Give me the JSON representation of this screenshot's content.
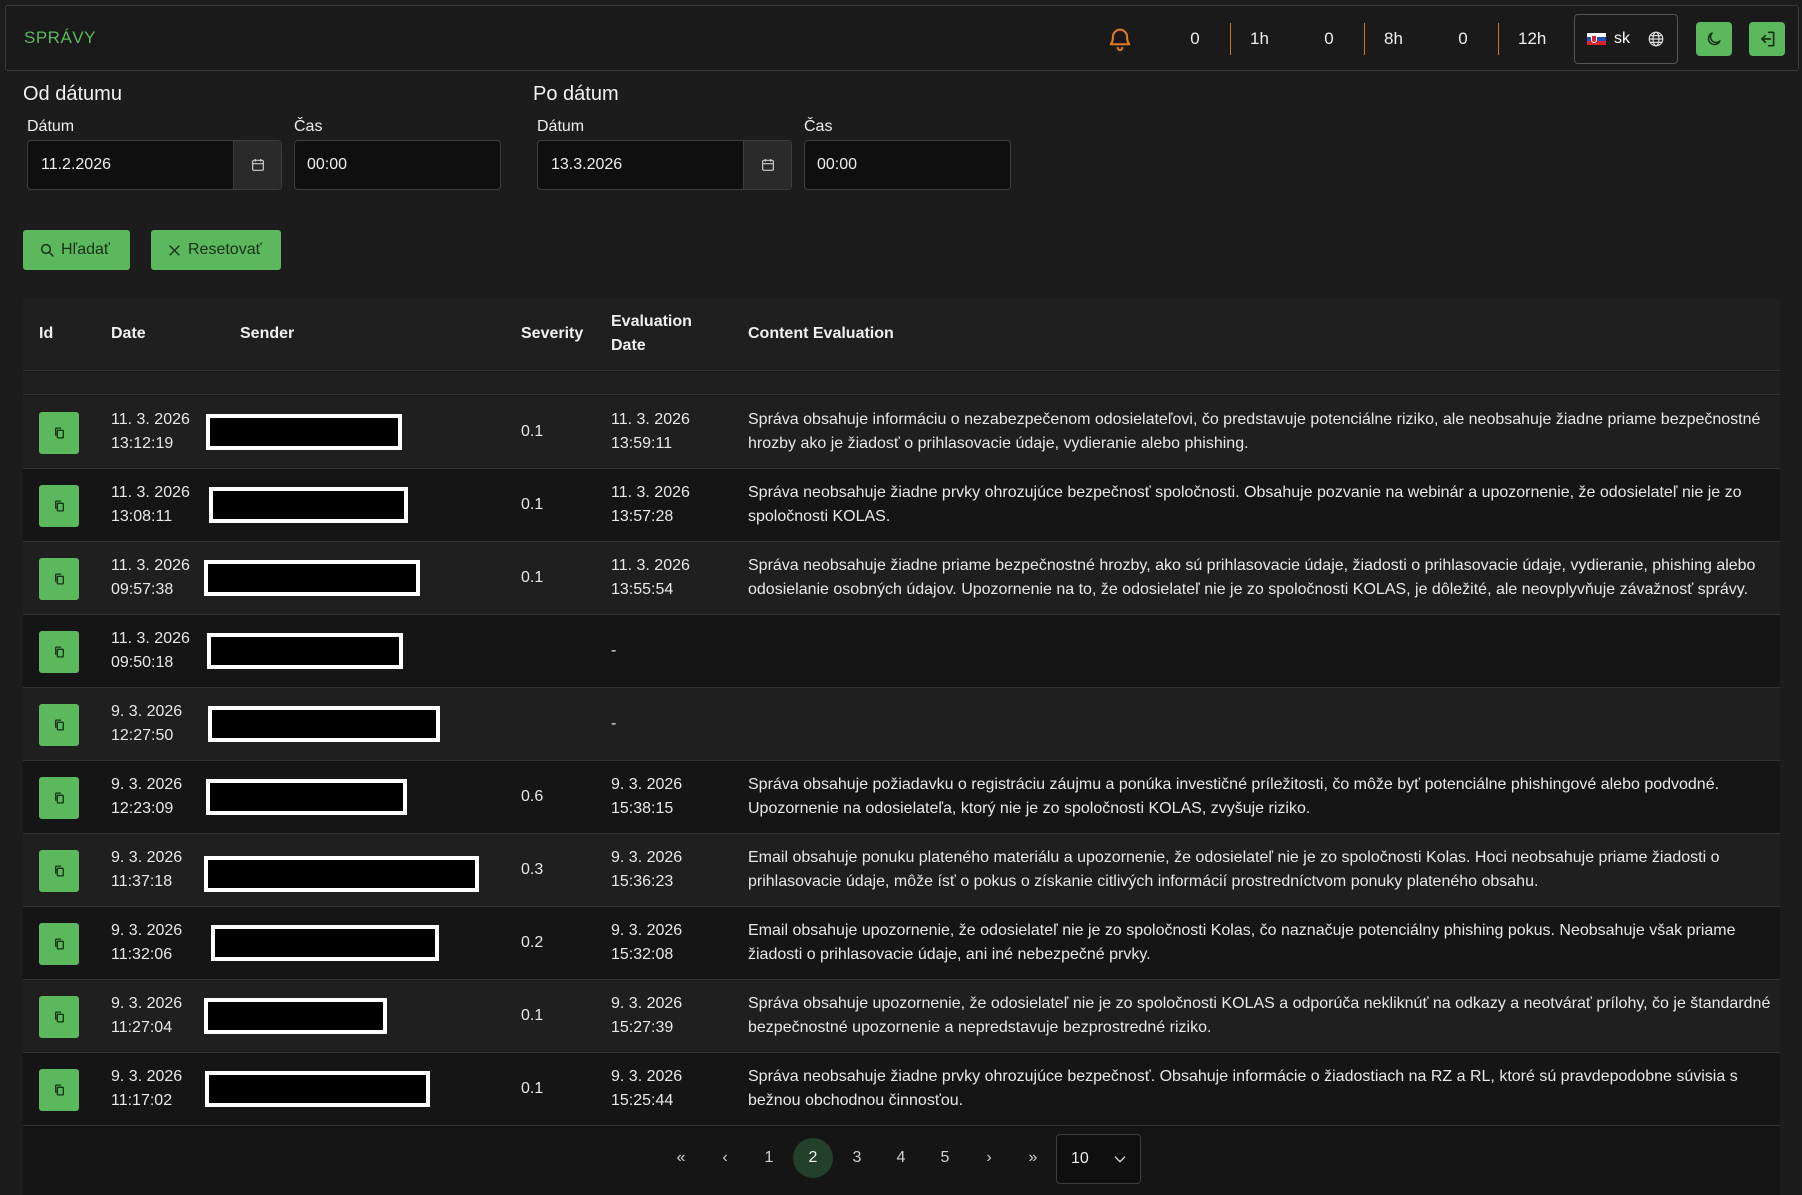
{
  "brand": "SPRÁVY",
  "header_stats": [
    {
      "count": "0",
      "window": "1h"
    },
    {
      "count": "0",
      "window": "8h"
    },
    {
      "count": "0",
      "window": "12h"
    }
  ],
  "language": "sk",
  "colors": {
    "accent": "#5cb85c",
    "bell": "#e07b1a",
    "background": "#1c1c1c"
  },
  "filters": {
    "from": {
      "title": "Od dátumu",
      "date_label": "Dátum",
      "date_value": "11.2.2026",
      "time_label": "Čas",
      "time_value": "00:00"
    },
    "to": {
      "title": "Po dátum",
      "date_label": "Dátum",
      "date_value": "13.3.2026",
      "time_label": "Čas",
      "time_value": "00:00"
    }
  },
  "buttons": {
    "search": "Hľadať",
    "reset": "Resetovať"
  },
  "table": {
    "columns": {
      "id": "Id",
      "date": "Date",
      "sender": "Sender",
      "severity": "Severity",
      "eval_date_1": "Evaluation",
      "eval_date_2": "Date",
      "content": "Content Evaluation"
    },
    "rows": [
      {
        "date": "11. 3. 2026",
        "time": "13:12:19",
        "severity": "0.1",
        "eval_date": "11. 3. 2026",
        "eval_time": "13:59:11",
        "content": "Správa obsahuje informáciu o nezabezpečenom odosielateľovi, čo predstavuje potenciálne riziko, ale neobsahuje žiadne priame bezpečnostné hrozby ako je žiadosť o prihlasovacie údaje, vydieranie alebo phishing."
      },
      {
        "date": "11. 3. 2026",
        "time": "13:08:11",
        "severity": "0.1",
        "eval_date": "11. 3. 2026",
        "eval_time": "13:57:28",
        "content": "Správa neobsahuje žiadne prvky ohrozujúce bezpečnosť spoločnosti. Obsahuje pozvanie na webinár a upozornenie, že odosielateľ nie je zo spoločnosti KOLAS."
      },
      {
        "date": "11. 3. 2026",
        "time": "09:57:38",
        "severity": "0.1",
        "eval_date": "11. 3. 2026",
        "eval_time": "13:55:54",
        "content": "Správa neobsahuje žiadne priame bezpečnostné hrozby, ako sú prihlasovacie údaje, žiadosti o prihlasovacie údaje, vydieranie, phishing alebo odosielanie osobných údajov. Upozornenie na to, že odosielateľ nie je zo spoločnosti KOLAS, je dôležité, ale neovplyvňuje závažnosť správy."
      },
      {
        "date": "11. 3. 2026",
        "time": "09:50:18",
        "severity": "",
        "eval_date": "-",
        "eval_time": "",
        "content": ""
      },
      {
        "date": "9. 3. 2026",
        "time": "12:27:50",
        "severity": "",
        "eval_date": "-",
        "eval_time": "",
        "content": ""
      },
      {
        "date": "9. 3. 2026",
        "time": "12:23:09",
        "severity": "0.6",
        "eval_date": "9. 3. 2026",
        "eval_time": "15:38:15",
        "content": "Správa obsahuje požiadavku o registráciu záujmu a ponúka investičné príležitosti, čo môže byť potenciálne phishingové alebo podvodné. Upozornenie na odosielateľa, ktorý nie je zo spoločnosti KOLAS, zvyšuje riziko."
      },
      {
        "date": "9. 3. 2026",
        "time": "11:37:18",
        "severity": "0.3",
        "eval_date": "9. 3. 2026",
        "eval_time": "15:36:23",
        "content": "Email obsahuje ponuku plateného materiálu a upozornenie, že odosielateľ nie je zo spoločnosti Kolas. Hoci neobsahuje priame žiadosti o prihlasovacie údaje, môže ísť o pokus o získanie citlivých informácií prostredníctvom ponuky plateného obsahu."
      },
      {
        "date": "9. 3. 2026",
        "time": "11:32:06",
        "severity": "0.2",
        "eval_date": "9. 3. 2026",
        "eval_time": "15:32:08",
        "content": "Email obsahuje upozornenie, že odosielateľ nie je zo spoločnosti Kolas, čo naznačuje potenciálny phishing pokus. Neobsahuje však priame žiadosti o prihlasovacie údaje, ani iné nebezpečné prvky."
      },
      {
        "date": "9. 3. 2026",
        "time": "11:27:04",
        "severity": "0.1",
        "eval_date": "9. 3. 2026",
        "eval_time": "15:27:39",
        "content": "Správa obsahuje upozornenie, že odosielateľ nie je zo spoločnosti KOLAS a odporúča nekliknúť na odkazy a neotvárať prílohy, čo je štandardné bezpečnostné upozornenie a nepredstavuje bezprostredné riziko."
      },
      {
        "date": "9. 3. 2026",
        "time": "11:17:02",
        "severity": "0.1",
        "eval_date": "9. 3. 2026",
        "eval_time": "15:25:44",
        "content": "Správa neobsahuje žiadne prvky ohrozujúce bezpečnosť. Obsahuje informácie o žiadostiach na RZ a RL, ktoré sú pravdepodobne súvisia s bežnou obchodnou činnosťou."
      }
    ]
  },
  "pagination": {
    "first": "«",
    "prev": "‹",
    "pages": [
      "1",
      "2",
      "3",
      "4",
      "5"
    ],
    "active_page": "2",
    "next": "›",
    "last": "»",
    "page_size": "10"
  }
}
